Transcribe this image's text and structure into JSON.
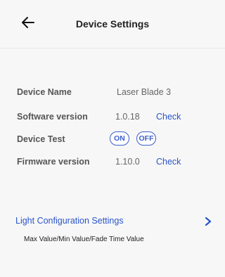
{
  "header": {
    "title": "Device Settings",
    "back_icon": "arrow-left-icon"
  },
  "settings": {
    "device_name": {
      "label": "Device Name",
      "value": "Laser Blade 3"
    },
    "software_version": {
      "label": "Software version",
      "value": "1.0.18",
      "action": "Check"
    },
    "device_test": {
      "label": "Device Test",
      "on_label": "ON",
      "off_label": "OFF"
    },
    "firmware_version": {
      "label": "Firmware version",
      "value": "1.10.0",
      "action": "Check"
    }
  },
  "light_config": {
    "title": "Light Configuration Settings",
    "subtitle": "Max Value/Min Value/Fade Time Value",
    "chevron_icon": "chevron-right-icon"
  },
  "colors": {
    "accent": "#2a55c9",
    "background": "#f7f7f7",
    "label": "#555555"
  }
}
